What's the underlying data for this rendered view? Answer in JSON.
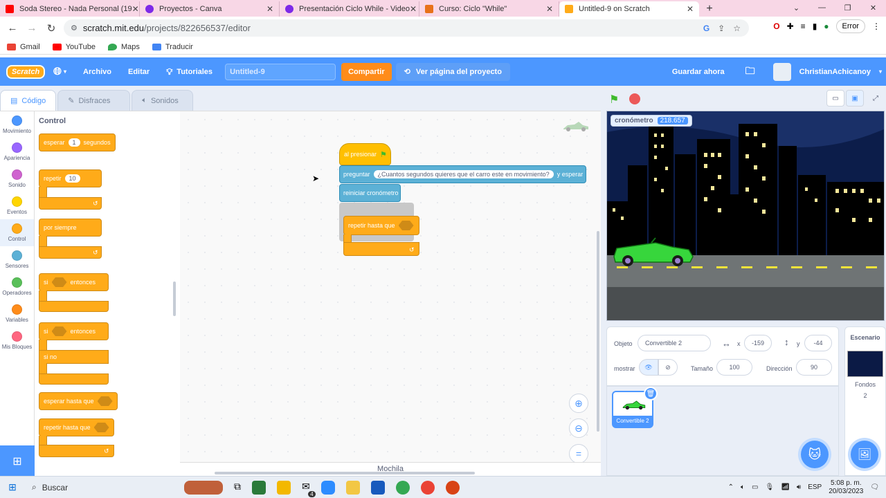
{
  "browser": {
    "tabs": [
      {
        "title": "Soda Stereo - Nada Personal (19",
        "color": "#ff0000"
      },
      {
        "title": "Proyectos - Canva",
        "color": "#7d2ae8"
      },
      {
        "title": "Presentación Ciclo While - Video",
        "color": "#7d2ae8"
      },
      {
        "title": "Curso: Ciclo \"While\"",
        "color": "#e8711a"
      },
      {
        "title": "Untitled-9 on Scratch",
        "color": "#ffab19"
      }
    ],
    "url_host": "scratch.mit.edu",
    "url_path": "/projects/822656537/editor",
    "error_label": "Error",
    "bookmarks": [
      {
        "label": "Gmail",
        "color": "#ea4335"
      },
      {
        "label": "YouTube",
        "color": "#ff0000"
      },
      {
        "label": "Maps",
        "color": "#34a853"
      },
      {
        "label": "Traducir",
        "color": "#4285f4"
      }
    ]
  },
  "menubar": {
    "logo": "Scratch",
    "file": "Archivo",
    "edit": "Editar",
    "tutorials": "Tutoriales",
    "project_title": "Untitled-9",
    "share": "Compartir",
    "see_project": "Ver página del proyecto",
    "save_now": "Guardar ahora",
    "username": "ChristianAchicanoy"
  },
  "editor_tabs": {
    "code": "Código",
    "costumes": "Disfraces",
    "sounds": "Sonidos"
  },
  "categories": [
    {
      "label": "Movimiento",
      "color": "#4c97ff"
    },
    {
      "label": "Apariencia",
      "color": "#9966ff"
    },
    {
      "label": "Sonido",
      "color": "#cf63cf"
    },
    {
      "label": "Eventos",
      "color": "#ffd500"
    },
    {
      "label": "Control",
      "color": "#ffab19"
    },
    {
      "label": "Sensores",
      "color": "#5cb1d6"
    },
    {
      "label": "Operadores",
      "color": "#59c059"
    },
    {
      "label": "Variables",
      "color": "#ff8c1a"
    },
    {
      "label": "Mis Bloques",
      "color": "#ff6680"
    }
  ],
  "palette": {
    "heading": "Control",
    "wait_a": "esperar",
    "wait_val": "1",
    "wait_b": "segundos",
    "repeat": "repetir",
    "repeat_val": "10",
    "forever": "por siempre",
    "if": "si",
    "then": "entonces",
    "if2": "si",
    "then2": "entonces",
    "else": "si no",
    "wait_until": "esperar hasta que",
    "repeat_until": "repetir hasta que"
  },
  "script": {
    "hat": "al presionar",
    "ask_a": "preguntar",
    "ask_text": "¿Cuantos segundos quieres que el carro este en movimiento?",
    "ask_b": "y esperar",
    "reset_timer": "reiniciar cronómetro",
    "repeat_until": "repetir hasta que"
  },
  "backpack": "Mochila",
  "stage": {
    "monitor_label": "cronómetro",
    "monitor_value": "218.657"
  },
  "sprite_info": {
    "object_label": "Objeto",
    "object_name": "Convertible 2",
    "x_label": "x",
    "x_value": "-159",
    "y_label": "y",
    "y_value": "-44",
    "show_label": "mostrar",
    "size_label": "Tamaño",
    "size_value": "100",
    "direction_label": "Dirección",
    "direction_value": "90"
  },
  "sprites": [
    {
      "name": "Convertible 2"
    }
  ],
  "stage_panel": {
    "title": "Escenario",
    "backdrops_label": "Fondos",
    "backdrops_count": "2"
  },
  "taskbar": {
    "search": "Buscar",
    "lang": "ESP",
    "time": "5:08 p. m.",
    "date": "20/03/2023",
    "mail_badge": "4"
  }
}
